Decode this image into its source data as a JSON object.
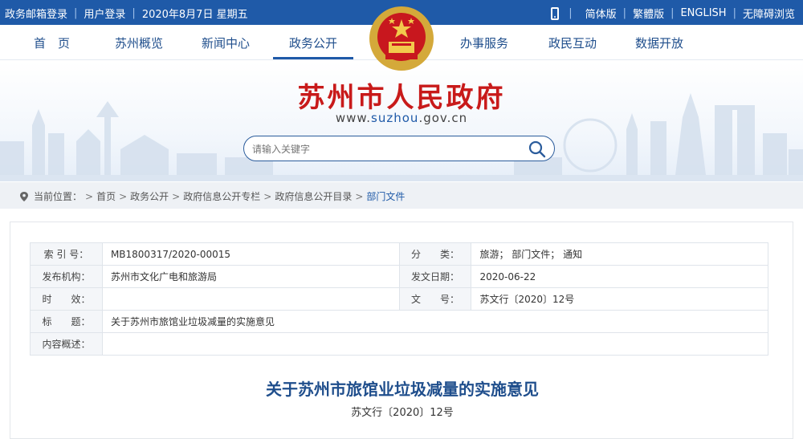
{
  "topbar": {
    "links": [
      "政务邮箱登录",
      "用户登录"
    ],
    "date": "2020年8月7日 星期五",
    "right": [
      "简体版",
      "繁體版",
      "ENGLISH",
      "无障碍浏览"
    ]
  },
  "nav": {
    "items": [
      "首　页",
      "苏州概览",
      "新闻中心",
      "政务公开",
      "办事服务",
      "政民互动",
      "数据开放"
    ],
    "active": "政务公开"
  },
  "header": {
    "title": "苏州市人民政府",
    "url_prefix": "www.",
    "url_highlight": "suzhou",
    "url_suffix": ".gov.cn"
  },
  "search": {
    "placeholder": "请输入关键字"
  },
  "breadcrumb": {
    "label": "当前位置：",
    "items": [
      "首页",
      "政务公开",
      "政府信息公开专栏",
      "政府信息公开目录",
      "部门文件"
    ]
  },
  "meta": {
    "rows": [
      {
        "k1": "索 引 号：",
        "v1": "MB1800317/2020-00015",
        "k2": "分　　类：",
        "v2": "旅游；  部门文件；  通知"
      },
      {
        "k1": "发布机构：",
        "v1": "苏州市文化广电和旅游局",
        "k2": "发文日期：",
        "v2": "2020-06-22"
      },
      {
        "k1": "时　　效：",
        "v1": "",
        "k2": "文　　号：",
        "v2": "苏文行〔2020〕12号"
      }
    ],
    "title_label": "标　　题：",
    "title_value": "关于苏州市旅馆业垃圾减量的实施意见",
    "summary_label": "内容概述：",
    "summary_value": ""
  },
  "document": {
    "title": "关于苏州市旅馆业垃圾减量的实施意见",
    "number": "苏文行〔2020〕12号"
  },
  "colors": {
    "brand_blue": "#1f5aa8",
    "title_red": "#c81a1a"
  }
}
